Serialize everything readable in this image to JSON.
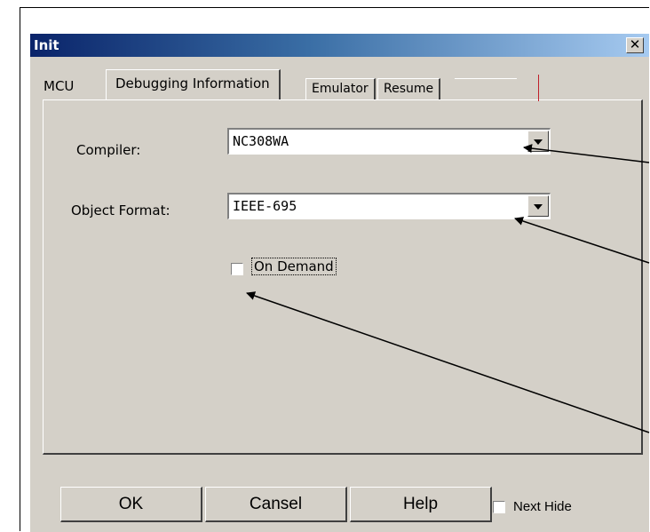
{
  "window": {
    "title": "Init",
    "close_glyph": "✕"
  },
  "tabs": [
    {
      "label": "MCU",
      "active": false
    },
    {
      "label": "Debugging Information",
      "active": true
    },
    {
      "label": "Emulator",
      "active": false
    },
    {
      "label": "Resume",
      "active": false
    }
  ],
  "form": {
    "compiler_label": "Compiler:",
    "compiler_value": "NC308WA",
    "format_label": "Object Format:",
    "format_value": "IEEE-695",
    "on_demand_label": "On Demand",
    "on_demand_checked": false
  },
  "buttons": {
    "ok": "OK",
    "cansel": "Cansel",
    "help": "Help"
  },
  "next_hide": {
    "label": "Next Hide",
    "checked": false
  },
  "colors": {
    "title_start": "#0a246a",
    "title_end": "#a6caf0",
    "dialog_face": "#d4d0c8",
    "accent_red": "#c0202a"
  }
}
